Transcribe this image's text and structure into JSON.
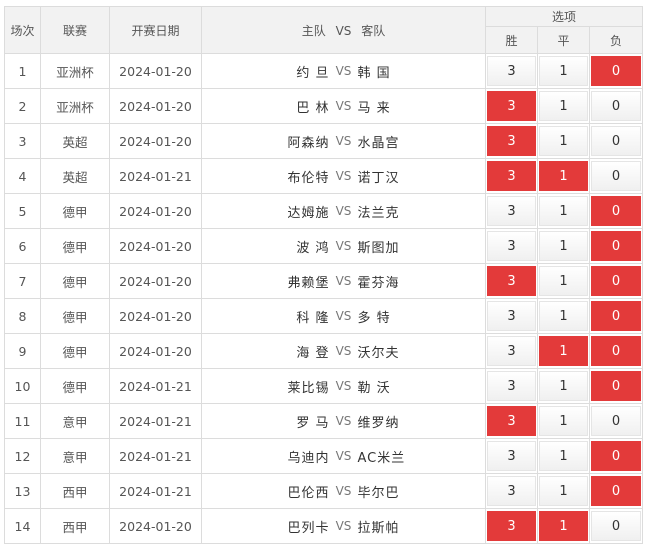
{
  "header": {
    "idx": "场次",
    "league": "联赛",
    "date": "开赛日期",
    "match_home": "主队",
    "match_vs": "VS",
    "match_away": "客队",
    "options": "选项",
    "win": "胜",
    "draw": "平",
    "lose": "负"
  },
  "accent_color": "#e33a3a",
  "rows": [
    {
      "idx": "1",
      "league": "亚洲杯",
      "date": "2024-01-20",
      "home": "约 旦",
      "vs": "VS",
      "away": "韩 国",
      "win": "3",
      "draw": "1",
      "lose": "0",
      "selected": [
        "lose"
      ]
    },
    {
      "idx": "2",
      "league": "亚洲杯",
      "date": "2024-01-20",
      "home": "巴 林",
      "vs": "VS",
      "away": "马 来",
      "win": "3",
      "draw": "1",
      "lose": "0",
      "selected": [
        "win"
      ]
    },
    {
      "idx": "3",
      "league": "英超",
      "date": "2024-01-20",
      "home": "阿森纳",
      "vs": "VS",
      "away": "水晶宫",
      "win": "3",
      "draw": "1",
      "lose": "0",
      "selected": [
        "win"
      ]
    },
    {
      "idx": "4",
      "league": "英超",
      "date": "2024-01-21",
      "home": "布伦特",
      "vs": "VS",
      "away": "诺丁汉",
      "win": "3",
      "draw": "1",
      "lose": "0",
      "selected": [
        "win",
        "draw"
      ]
    },
    {
      "idx": "5",
      "league": "德甲",
      "date": "2024-01-20",
      "home": "达姆施",
      "vs": "VS",
      "away": "法兰克",
      "win": "3",
      "draw": "1",
      "lose": "0",
      "selected": [
        "lose"
      ]
    },
    {
      "idx": "6",
      "league": "德甲",
      "date": "2024-01-20",
      "home": "波 鸿",
      "vs": "VS",
      "away": "斯图加",
      "win": "3",
      "draw": "1",
      "lose": "0",
      "selected": [
        "lose"
      ]
    },
    {
      "idx": "7",
      "league": "德甲",
      "date": "2024-01-20",
      "home": "弗赖堡",
      "vs": "VS",
      "away": "霍芬海",
      "win": "3",
      "draw": "1",
      "lose": "0",
      "selected": [
        "win",
        "lose"
      ]
    },
    {
      "idx": "8",
      "league": "德甲",
      "date": "2024-01-20",
      "home": "科 隆",
      "vs": "VS",
      "away": "多 特",
      "win": "3",
      "draw": "1",
      "lose": "0",
      "selected": [
        "lose"
      ]
    },
    {
      "idx": "9",
      "league": "德甲",
      "date": "2024-01-20",
      "home": "海 登",
      "vs": "VS",
      "away": "沃尔夫",
      "win": "3",
      "draw": "1",
      "lose": "0",
      "selected": [
        "draw",
        "lose"
      ]
    },
    {
      "idx": "10",
      "league": "德甲",
      "date": "2024-01-21",
      "home": "莱比锡",
      "vs": "VS",
      "away": "勒 沃",
      "win": "3",
      "draw": "1",
      "lose": "0",
      "selected": [
        "lose"
      ]
    },
    {
      "idx": "11",
      "league": "意甲",
      "date": "2024-01-21",
      "home": "罗 马",
      "vs": "VS",
      "away": "维罗纳",
      "win": "3",
      "draw": "1",
      "lose": "0",
      "selected": [
        "win"
      ]
    },
    {
      "idx": "12",
      "league": "意甲",
      "date": "2024-01-21",
      "home": "乌迪内",
      "vs": "VS",
      "away": "AC米兰",
      "win": "3",
      "draw": "1",
      "lose": "0",
      "selected": [
        "lose"
      ]
    },
    {
      "idx": "13",
      "league": "西甲",
      "date": "2024-01-21",
      "home": "巴伦西",
      "vs": "VS",
      "away": "毕尔巴",
      "win": "3",
      "draw": "1",
      "lose": "0",
      "selected": [
        "lose"
      ]
    },
    {
      "idx": "14",
      "league": "西甲",
      "date": "2024-01-20",
      "home": "巴列卡",
      "vs": "VS",
      "away": "拉斯帕",
      "win": "3",
      "draw": "1",
      "lose": "0",
      "selected": [
        "win",
        "draw"
      ]
    }
  ]
}
